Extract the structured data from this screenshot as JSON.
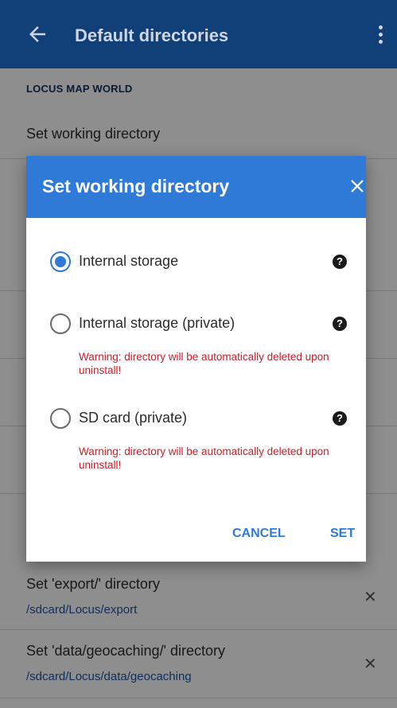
{
  "appbar": {
    "title": "Default directories",
    "back_icon": "arrow-left-icon",
    "more_icon": "more-vert-icon"
  },
  "list": {
    "section": "LOCUS MAP WORLD",
    "working_dir_title": "Set working directory",
    "rows": [
      {
        "title": "Set 'export/' directory",
        "path": "/sdcard/Locus/export"
      },
      {
        "title": "Set 'data/geocaching/' directory",
        "path": "/sdcard/Locus/data/geocaching"
      }
    ],
    "clear_glyph": "✕"
  },
  "dialog": {
    "title": "Set working directory",
    "close_glyph": "✕",
    "options": [
      {
        "label": "Internal storage",
        "checked": true,
        "warning": ""
      },
      {
        "label": "Internal storage (private)",
        "checked": false,
        "warning": "Warning: directory will be automatically deleted upon uninstall!"
      },
      {
        "label": "SD card (private)",
        "checked": false,
        "warning": "Warning: directory will be automatically deleted upon uninstall!"
      }
    ],
    "help_glyph": "?",
    "cancel_label": "CANCEL",
    "set_label": "SET"
  },
  "colors": {
    "appbar": "#113f78",
    "dialog_header": "#2f7ad6",
    "accent": "#2f7ad6",
    "warning": "#c8202b"
  }
}
